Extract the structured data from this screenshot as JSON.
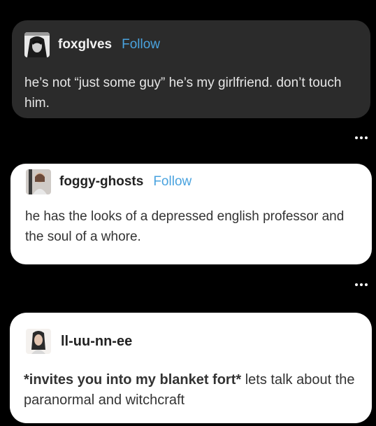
{
  "posts": [
    {
      "username": "foxglves",
      "follow_label": "Follow",
      "text": "he’s not “just some guy” he’s my girlfriend. don’t touch him."
    },
    {
      "username": "foggy-ghosts",
      "follow_label": "Follow",
      "text": "he has the looks of a depressed english professor and the soul of a whore."
    },
    {
      "username": "ll-uu-nn-ee",
      "text_bold": "*invites you into my blanket fort*",
      "text_rest": " lets talk about the paranormal and witchcraft"
    }
  ],
  "colors": {
    "follow": "#4aa3df",
    "dark_card": "#2b2b2b",
    "light_card": "#ffffff"
  }
}
